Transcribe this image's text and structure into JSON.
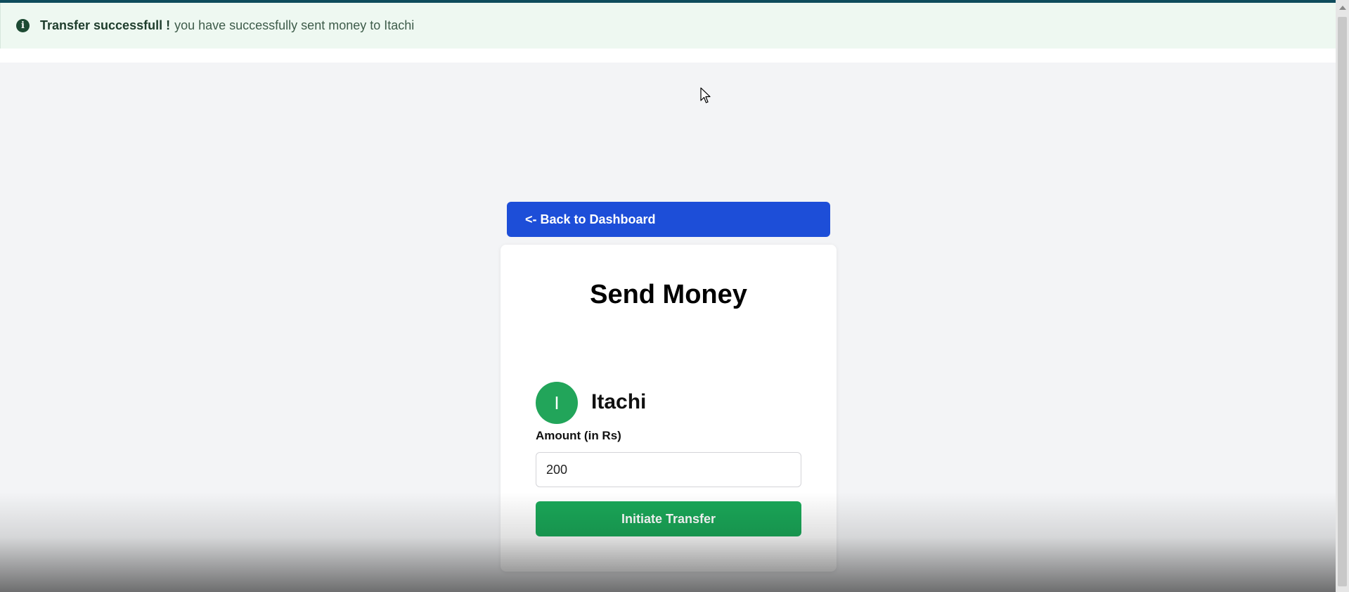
{
  "alert": {
    "icon": "info-icon",
    "title": "Transfer successfull !",
    "message": "you have successfully sent money to Itachi"
  },
  "back_button": {
    "label": "<- Back to Dashboard"
  },
  "card": {
    "title": "Send Money",
    "recipient": {
      "initial": "I",
      "name": "Itachi"
    },
    "amount_label": "Amount (in Rs)",
    "amount_value": "200",
    "submit_label": "Initiate Transfer"
  },
  "colors": {
    "primary": "#1d4ed8",
    "success": "#1aa758",
    "alert_bg": "#eef8f1",
    "page_bg": "#f3f4f6"
  }
}
